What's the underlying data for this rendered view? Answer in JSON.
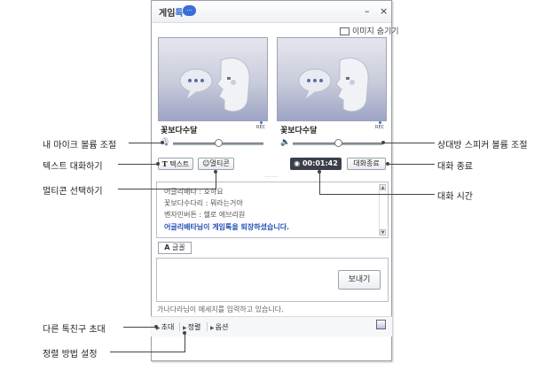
{
  "window": {
    "logo_text": "게임",
    "logo_accent": "톡",
    "logo_badge": "···",
    "minimize": "–",
    "close": "×",
    "hide_images": "이미지 숨기기"
  },
  "me": {
    "name": "꽃보다수달",
    "rec": "REC",
    "mic_volume": 0.5
  },
  "peer": {
    "name": "꽃보다수달",
    "rec": "REC",
    "speaker_volume": 0.5
  },
  "toolbar": {
    "text_button": "텍스트",
    "multicon_button": "멀티콘",
    "timer": "00:01:42",
    "end_button": "대화종료"
  },
  "chat": {
    "lines": [
      "어글리배타 : 호하요",
      "꽃보다수다리 : 뭐라는거야",
      "벤자민버튼 : 헬로 에브리원"
    ],
    "system_message": "어글리배타님이 게임톡을 퇴장하셨습니다."
  },
  "input": {
    "font_button": "글꼴",
    "send_button": "보내기",
    "status": "가나다라님이 메세지를 입력하고 있습니다."
  },
  "bottom": {
    "invite": "초대",
    "sort": "정렬",
    "options": "옵션"
  },
  "callouts": {
    "mic_volume": "내 마이크 볼륨 조절",
    "text_chat": "텍스트 대화하기",
    "multicon_select": "멀티콘 선택하기",
    "invite_friend": "다른 톡친구 초대",
    "sort_method": "정렬 방법 설정",
    "speaker_volume": "상대방 스피커 볼륨 조절",
    "end_chat": "대화 종료",
    "chat_time": "대화 시간"
  },
  "colors": {
    "accent": "#3a6dd6",
    "system_text": "#2450b8",
    "timer_bg": "#3b3f4a"
  }
}
